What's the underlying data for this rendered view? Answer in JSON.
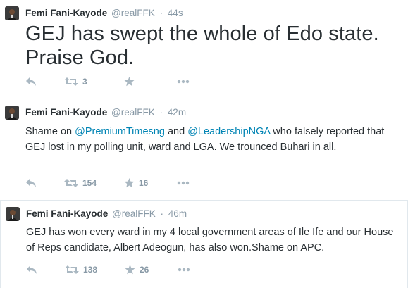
{
  "tweets": [
    {
      "name": "Femi Fani-Kayode",
      "handle": "@realFFK",
      "separator": "·",
      "time": "44s",
      "text": "GEJ has swept the whole of Edo state. Praise God.",
      "retweets": "3",
      "favorites": ""
    },
    {
      "name": "Femi Fani-Kayode",
      "handle": "@realFFK",
      "separator": "·",
      "time": "42m",
      "text_parts": [
        "Shame on ",
        "@PremiumTimesng",
        " and ",
        "@LeadershipNGA",
        " who falsely reported that GEJ lost in my polling unit, ward and LGA. We trounced Buhari in all."
      ],
      "retweets": "154",
      "favorites": "16"
    },
    {
      "name": "Femi Fani-Kayode",
      "handle": "@realFFK",
      "separator": "·",
      "time": "46m",
      "text": "GEJ has won every ward in my 4 local government areas of Ile Ife and our House of Reps candidate, Albert Adeogun, has also won.Shame on APC.",
      "retweets": "138",
      "favorites": "26"
    }
  ],
  "icons": {
    "reply": "reply-icon",
    "retweet": "retweet-icon",
    "favorite": "star-icon",
    "more": "more-icon"
  },
  "colors": {
    "link": "#0084b4",
    "muted": "#8899a6",
    "icon": "#aab8c2",
    "text": "#292f33"
  }
}
